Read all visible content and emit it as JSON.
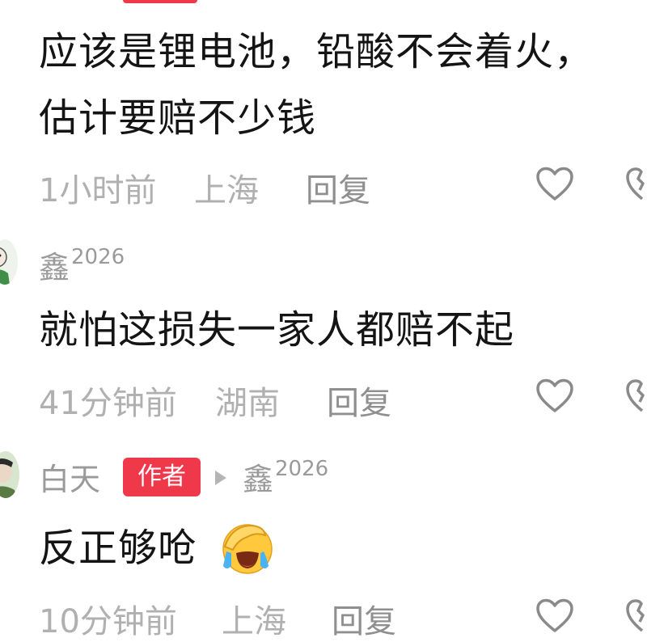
{
  "comments": [
    {
      "text_line1": "应该是锂电池，铅酸不会着火，",
      "text_line2": "估计要赔不少钱",
      "time": "1小时前",
      "location": "上海",
      "reply_label": "回复"
    },
    {
      "username": "鑫",
      "username_suffix": "2026",
      "text": "就怕这损失一家人都赔不起",
      "time": "41分钟前",
      "location": "湖南",
      "reply_label": "回复"
    },
    {
      "username": "白天",
      "author_badge": "作者",
      "reply_to_user": "鑫",
      "reply_to_suffix": "2026",
      "text": "反正够呛",
      "emoji": "facepalm-crying-emoji",
      "time": "10分钟前",
      "location": "上海",
      "reply_label": "回复"
    }
  ],
  "colors": {
    "author_badge": "#f0384b",
    "meta_text": "#b0b0b0",
    "comment_text": "#141414"
  },
  "icons": [
    "heart-icon",
    "dislike-icon",
    "reply-arrow-icon",
    "emoji-icon"
  ]
}
